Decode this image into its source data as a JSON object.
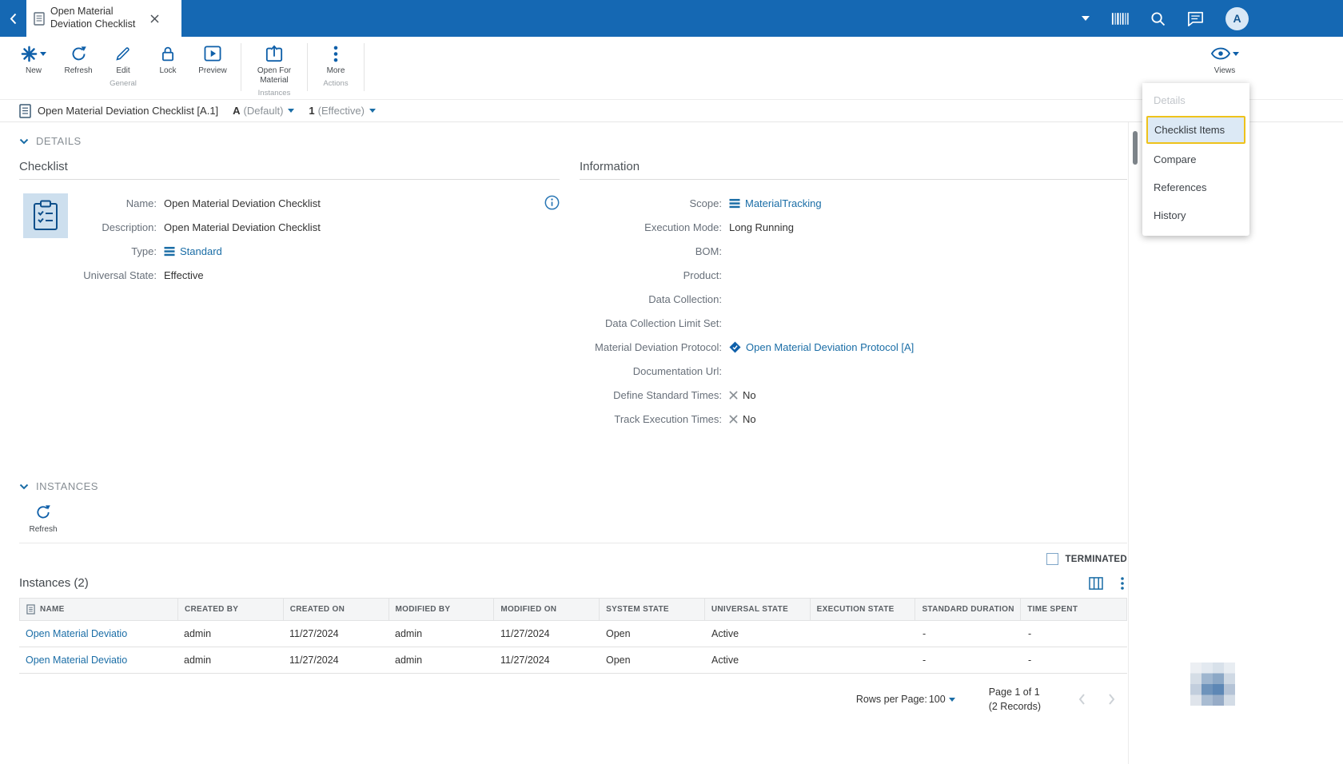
{
  "colors": {
    "topbar": "#1568b3",
    "accent": "#0e5fa9",
    "link": "#1a6da6",
    "highlight": "#eec21b",
    "selected_bg": "#dce9f5"
  },
  "topbar": {
    "tab_title": "Open Material Deviation Checklist",
    "avatar_initial": "A"
  },
  "toolbar": {
    "groups": [
      {
        "label": "General",
        "buttons": [
          {
            "label": "New"
          },
          {
            "label": "Refresh"
          },
          {
            "label": "Edit"
          },
          {
            "label": "Lock"
          },
          {
            "label": "Preview"
          }
        ]
      },
      {
        "label": "Instances",
        "buttons": [
          {
            "label": "Open For Material"
          }
        ]
      },
      {
        "label": "Actions",
        "buttons": [
          {
            "label": "More"
          }
        ]
      }
    ],
    "views_label": "Views"
  },
  "breadcrumb": {
    "title": "Open Material Deviation Checklist [A.1]",
    "version": "A",
    "version_state": "(Default)",
    "revision": "1",
    "revision_state": "(Effective)"
  },
  "views_menu": {
    "items": [
      {
        "label": "Details",
        "state": "disabled"
      },
      {
        "label": "Checklist Items",
        "state": "focused"
      },
      {
        "label": "Compare",
        "state": "normal"
      },
      {
        "label": "References",
        "state": "normal"
      },
      {
        "label": "History",
        "state": "normal"
      }
    ]
  },
  "details": {
    "section_title": "DETAILS",
    "checklist": {
      "title": "Checklist",
      "name": {
        "label": "Name:",
        "value": "Open Material Deviation Checklist"
      },
      "description": {
        "label": "Description:",
        "value": "Open Material Deviation Checklist"
      },
      "type": {
        "label": "Type:",
        "value": "Standard"
      },
      "universal_state": {
        "label": "Universal State:",
        "value": "Effective"
      }
    },
    "information": {
      "title": "Information",
      "scope": {
        "label": "Scope:",
        "value": "MaterialTracking"
      },
      "execution_mode": {
        "label": "Execution Mode:",
        "value": "Long Running"
      },
      "bom": {
        "label": "BOM:",
        "value": ""
      },
      "product": {
        "label": "Product:",
        "value": ""
      },
      "data_collection": {
        "label": "Data Collection:",
        "value": ""
      },
      "data_collection_limit_set": {
        "label": "Data Collection Limit Set:",
        "value": ""
      },
      "material_deviation_protocol": {
        "label": "Material Deviation Protocol:",
        "value": "Open Material Deviation Protocol [A]"
      },
      "documentation_url": {
        "label": "Documentation Url:",
        "value": ""
      },
      "define_standard_times": {
        "label": "Define Standard Times:",
        "value": "No"
      },
      "track_execution_times": {
        "label": "Track Execution Times:",
        "value": "No"
      }
    }
  },
  "instances": {
    "section_title": "INSTANCES",
    "refresh_label": "Refresh",
    "terminated_label": "TERMINATED",
    "table_title": "Instances (2)",
    "table": {
      "columns": [
        "NAME",
        "CREATED BY",
        "CREATED ON",
        "MODIFIED BY",
        "MODIFIED ON",
        "SYSTEM STATE",
        "UNIVERSAL STATE",
        "EXECUTION STATE",
        "STANDARD DURATION",
        "TIME SPENT"
      ],
      "rows": [
        {
          "name": "Open Material Deviatio",
          "created_by": "admin",
          "created_on": "11/27/2024",
          "modified_by": "admin",
          "modified_on": "11/27/2024",
          "system_state": "Open",
          "universal_state": "Active",
          "execution_state": "",
          "standard_duration": "-",
          "time_spent": "-"
        },
        {
          "name": "Open Material Deviatio",
          "created_by": "admin",
          "created_on": "11/27/2024",
          "modified_by": "admin",
          "modified_on": "11/27/2024",
          "system_state": "Open",
          "universal_state": "Active",
          "execution_state": "",
          "standard_duration": "-",
          "time_spent": "-"
        }
      ]
    },
    "footer": {
      "rows_per_page_label": "Rows per Page:",
      "rows_per_page_value": "100",
      "page_info": "Page 1 of 1",
      "records_info": "(2 Records)"
    }
  },
  "icons": {
    "back": "chevron-left",
    "tab_document": "document",
    "close": "x",
    "tabs_dropdown": "chevron-down",
    "barcode": "barcode",
    "search": "magnifier",
    "chat": "speech-bubble",
    "new": "asterisk",
    "refresh": "circular-arrow",
    "edit": "pencil",
    "lock": "padlock",
    "preview": "play-in-frame",
    "open_for_material": "box-arrow-up",
    "more": "vertical-dots",
    "views": "eye",
    "info": "circled-i",
    "type": "list",
    "scope": "list",
    "protocol": "diamond-check",
    "no": "x-mark",
    "column_chooser": "table-columns",
    "pagination_prev": "chevron-left",
    "pagination_next": "chevron-right"
  }
}
